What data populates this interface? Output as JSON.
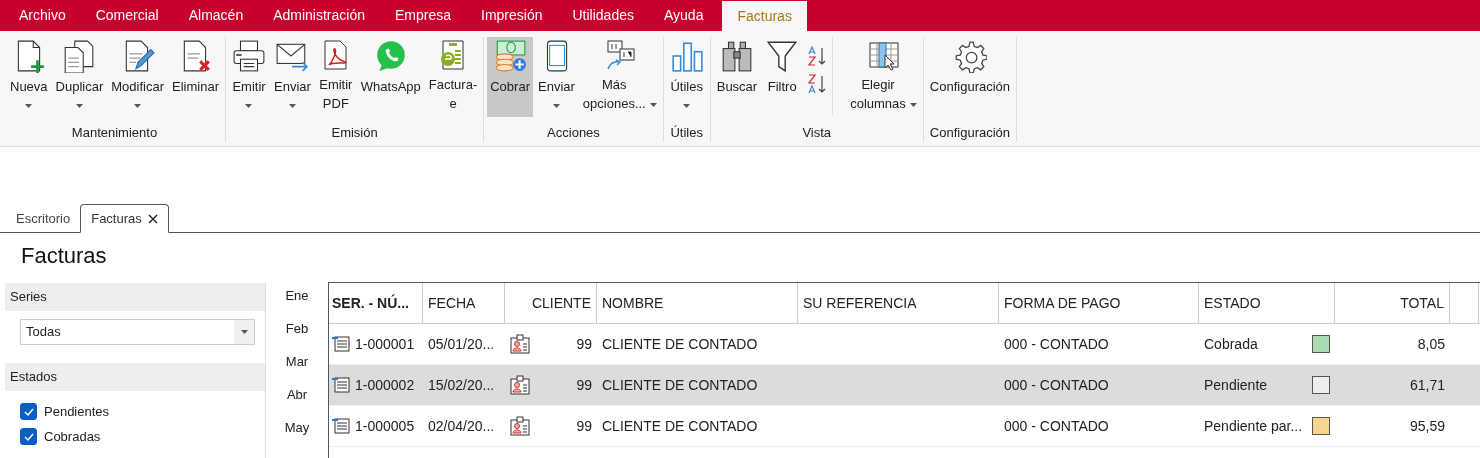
{
  "menu": [
    {
      "label": "Archivo",
      "selected": false
    },
    {
      "label": "Comercial",
      "selected": false
    },
    {
      "label": "Almacén",
      "selected": false
    },
    {
      "label": "Administración",
      "selected": false
    },
    {
      "label": "Empresa",
      "selected": false
    },
    {
      "label": "Impresión",
      "selected": false
    },
    {
      "label": "Utilidades",
      "selected": false
    },
    {
      "label": "Ayuda",
      "selected": false
    },
    {
      "label": "Facturas",
      "selected": true
    }
  ],
  "ribbon": [
    {
      "label": "Mantenimiento",
      "buttons": [
        {
          "kind": "split",
          "label": "Nueva",
          "selected": false
        },
        {
          "kind": "split",
          "label": "Duplicar",
          "selected": false
        },
        {
          "kind": "split",
          "label": "Modificar",
          "selected": false
        },
        {
          "kind": "plain",
          "label": "Eliminar",
          "selected": false
        }
      ]
    },
    {
      "label": "Emisión",
      "buttons": [
        {
          "kind": "split",
          "label": "Emitir",
          "selected": false
        },
        {
          "kind": "split",
          "label": "Enviar",
          "selected": false
        },
        {
          "kind": "plain",
          "label": "Emitir PDF",
          "selected": false
        },
        {
          "kind": "plain",
          "label": "WhatsApp",
          "selected": false
        },
        {
          "kind": "plain",
          "label": "Factura-e",
          "selected": false
        }
      ]
    },
    {
      "label": "Acciones",
      "buttons": [
        {
          "kind": "plain",
          "label": "Cobrar",
          "selected": true
        },
        {
          "kind": "split",
          "label": "Enviar",
          "selected": false
        },
        {
          "kind": "menu",
          "label": "Más opciones...",
          "selected": false
        }
      ]
    },
    {
      "label": "Útiles",
      "buttons": [
        {
          "kind": "split",
          "label": "Útiles",
          "selected": false
        }
      ]
    },
    {
      "label": "Vista",
      "buttons": [
        {
          "kind": "plain",
          "label": "Buscar",
          "selected": false
        },
        {
          "kind": "plain",
          "label": "Filtro",
          "selected": false
        },
        {
          "kind": "sort"
        },
        {
          "kind": "menu",
          "label": "Elegir columnas",
          "selected": false
        }
      ]
    },
    {
      "label": "Configuración",
      "buttons": [
        {
          "kind": "plain",
          "label": "Configuración",
          "selected": false
        }
      ]
    }
  ],
  "doc_tabs": [
    {
      "label": "Escritorio",
      "selected": false,
      "closable": false
    },
    {
      "label": "Facturas",
      "selected": true,
      "closable": true
    }
  ],
  "page_title": "Facturas",
  "filters": {
    "series_heading": "Series",
    "series_value": "Todas",
    "states_heading": "Estados",
    "states": [
      {
        "label": "Pendientes",
        "checked": true
      },
      {
        "label": "Cobradas",
        "checked": true
      }
    ]
  },
  "months": [
    "Ene",
    "Feb",
    "Mar",
    "Abr",
    "May"
  ],
  "table": {
    "columns": [
      {
        "label": "SER. - NÚ...",
        "sorted": true,
        "numeric": false
      },
      {
        "label": "FECHA",
        "sorted": false,
        "numeric": false
      },
      {
        "label": "CLIENTE",
        "sorted": false,
        "numeric": true
      },
      {
        "label": "NOMBRE",
        "sorted": false,
        "numeric": false
      },
      {
        "label": "SU REFERENCIA",
        "sorted": false,
        "numeric": false
      },
      {
        "label": "FORMA DE PAGO",
        "sorted": false,
        "numeric": false
      },
      {
        "label": "ESTADO",
        "sorted": false,
        "numeric": false
      },
      {
        "label": "TOTAL",
        "sorted": false,
        "numeric": true
      }
    ],
    "rows": [
      {
        "number": "1-000001",
        "date": "05/01/20...",
        "client": "99",
        "name": "CLIENTE DE CONTADO",
        "payment": "000 - CONTADO",
        "status": "Cobrada",
        "color": "#a8dcb4",
        "total": "8,05",
        "selected": false
      },
      {
        "number": "1-000002",
        "date": "15/02/20...",
        "client": "99",
        "name": "CLIENTE DE CONTADO",
        "payment": "000 - CONTADO",
        "status": "Pendiente",
        "color": "#eeeeee",
        "total": "61,71",
        "selected": true
      },
      {
        "number": "1-000005",
        "date": "02/04/20...",
        "client": "99",
        "name": "CLIENTE DE CONTADO",
        "payment": "000 - CONTADO",
        "status": "Pendiente par...",
        "color": "#f8d48c",
        "total": "95,59",
        "selected": false
      }
    ]
  }
}
